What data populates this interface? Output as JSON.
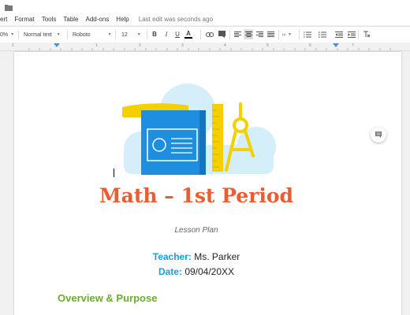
{
  "menu": {
    "items": [
      "ert",
      "Format",
      "Tools",
      "Table",
      "Add-ons",
      "Help"
    ],
    "last_edit": "Last edit was seconds ago"
  },
  "toolbar": {
    "zoom": "0%",
    "style": "Normal text",
    "font": "Roboto",
    "size": "12",
    "bold": "B",
    "italic": "I",
    "underline": "U",
    "text_color": "A"
  },
  "ruler": {
    "numbers": [
      "1",
      "1",
      "2",
      "3",
      "4",
      "5",
      "6",
      "7"
    ]
  },
  "document": {
    "title": "Math – 1st Period",
    "subtitle": "Lesson Plan",
    "teacher_label": "Teacher",
    "teacher_name": "Ms. Parker",
    "date_label": "Date",
    "date_value": "09/04/20XX",
    "section_heading": "Overview & Purpose"
  },
  "icons": [
    "folder-icon",
    "print-icon",
    "undo-icon",
    "redo-icon",
    "link-icon",
    "insert-comment-icon",
    "align-left-icon",
    "align-center-icon",
    "align-right-icon",
    "align-justify-icon",
    "line-spacing-icon",
    "numbered-list-icon",
    "bulleted-list-icon",
    "decrease-indent-icon",
    "increase-indent-icon",
    "clear-formatting-icon",
    "comment-icon"
  ],
  "colors": {
    "title": "#ef5b30",
    "label_blue": "#1a9fd6",
    "heading_green": "#6aac2c",
    "book_blue": "#1e8fe0",
    "ruler_yellow": "#f5d000",
    "cloud": "#d4eefa"
  }
}
